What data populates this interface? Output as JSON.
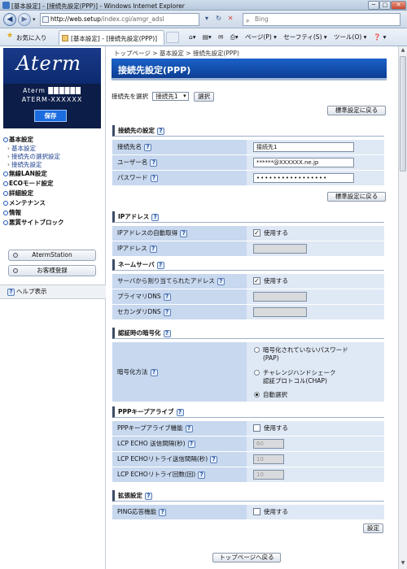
{
  "window": {
    "title": "[基本設定] - [接続先設定(PPP)] - Windows Internet Explorer",
    "min": "─",
    "max": "□",
    "close": "✕"
  },
  "address": {
    "host": "http://web.setup",
    "path": "/index.cgi/amgr_adsl",
    "search_placeholder": "Bing"
  },
  "favorites": {
    "label": "お気に入り",
    "tab_title": "[基本設定] - [接続先設定(PPP)]",
    "commands": [
      "ページ(P) ▾",
      "セーフティ(S) ▾",
      "ツール(O) ▾",
      "❓ ▾"
    ]
  },
  "sidebar": {
    "logo": "Aterm",
    "model_line1": "Aterm ██████",
    "model_line2": "ATERM-XXXXXX",
    "save_label": "保存",
    "menu": {
      "basic": "基本設定",
      "basic_subs": [
        "基本設定",
        "接続先の選択設定",
        "接続先設定"
      ],
      "items": [
        "無線LAN設定",
        "ECOモード設定",
        "詳細設定",
        "メンテナンス",
        "情報",
        "悪質サイトブロック"
      ]
    },
    "station_button": "AtermStation",
    "register_button": "お客様登録",
    "help_label": "ヘルプ表示"
  },
  "main": {
    "breadcrumb": "トップページ > 基本設定 > 接続先設定(PPP)",
    "title": "接続先設定(PPP)",
    "select_label": "接続先を選択",
    "select_value": "接続先1",
    "select_button": "選択",
    "reset_button": "標準設定に戻る",
    "help_icon": "?",
    "connection": {
      "header": "接続先の設定",
      "name_label": "接続先名",
      "name_value": "接続先1",
      "user_label": "ユーザー名",
      "user_value": "******@XXXXXX.ne.jp",
      "password_label": "パスワード",
      "password_value": "•••••••••••••••••",
      "reset_button": "標準設定に戻る"
    },
    "ip": {
      "header": "IPアドレス",
      "auto_label": "IPアドレスの自動取得",
      "auto_check": "使用する",
      "addr_label": "IPアドレス"
    },
    "dns": {
      "header": "ネームサーバ",
      "assigned_label": "サーバから割り当てられたアドレス",
      "assigned_check": "使用する",
      "primary_label": "プライマリDNS",
      "secondary_label": "セカンダリDNS"
    },
    "auth": {
      "header": "認証時の暗号化",
      "method_label": "暗号化方法",
      "opt1_line1": "暗号化されていないパスワード",
      "opt1_line2": "(PAP)",
      "opt2_line1": "チャレンジハンドシェーク",
      "opt2_line2": "認証プロトコル(CHAP)",
      "opt3": "自動選択"
    },
    "keepalive": {
      "header": "PPPキープアライブ",
      "func_label": "PPPキープアライブ機能",
      "func_check": "使用する",
      "interval_label": "LCP ECHO 送信間隔(秒)",
      "interval_value": "60",
      "retry_interval_label": "LCP ECHOリトライ送信間隔(秒)",
      "retry_interval_value": "10",
      "retry_count_label": "LCP ECHOリトライ回数(回)",
      "retry_count_value": "10"
    },
    "ext": {
      "header": "拡張設定",
      "ping_label": "PING応答機能",
      "ping_check": "使用する"
    },
    "set_button": "設定",
    "back_top_button": "トップページへ戻る"
  }
}
